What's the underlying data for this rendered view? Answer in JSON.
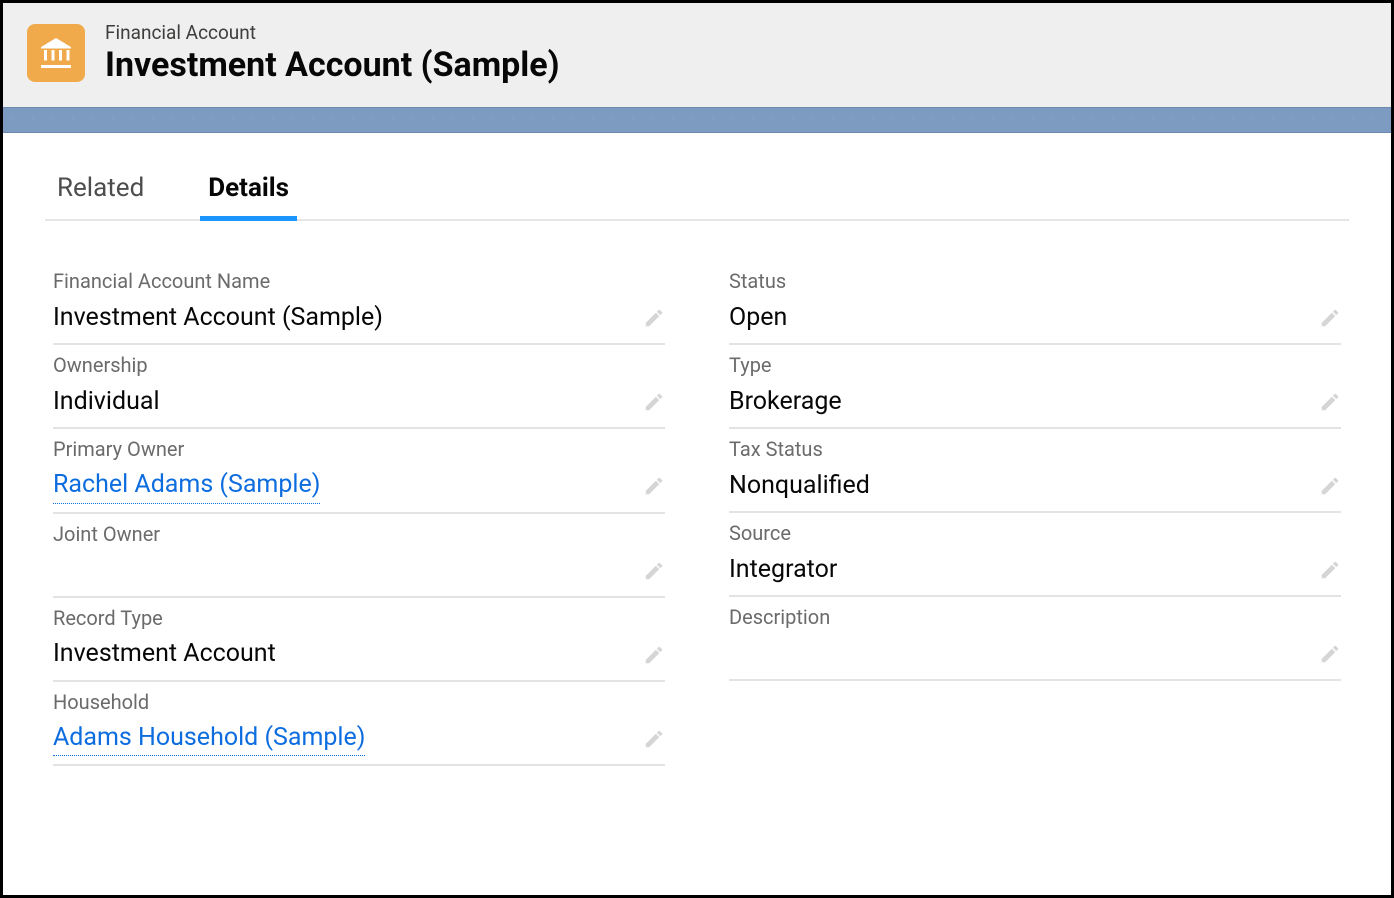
{
  "header": {
    "objectLabel": "Financial Account",
    "title": "Investment Account (Sample)"
  },
  "tabs": {
    "related": "Related",
    "details": "Details"
  },
  "fields": {
    "left": [
      {
        "label": "Financial Account Name",
        "value": "Investment Account (Sample)",
        "link": false
      },
      {
        "label": "Ownership",
        "value": "Individual",
        "link": false
      },
      {
        "label": "Primary Owner",
        "value": "Rachel Adams (Sample)",
        "link": true
      },
      {
        "label": "Joint Owner",
        "value": "",
        "link": false
      },
      {
        "label": "Record Type",
        "value": "Investment Account",
        "link": false
      },
      {
        "label": "Household",
        "value": "Adams Household (Sample)",
        "link": true
      }
    ],
    "right": [
      {
        "label": "Status",
        "value": "Open",
        "link": false
      },
      {
        "label": "Type",
        "value": "Brokerage",
        "link": false
      },
      {
        "label": "Tax Status",
        "value": "Nonqualified",
        "link": false
      },
      {
        "label": "Source",
        "value": "Integrator",
        "link": false
      },
      {
        "label": "Description",
        "value": "",
        "link": false
      }
    ]
  }
}
